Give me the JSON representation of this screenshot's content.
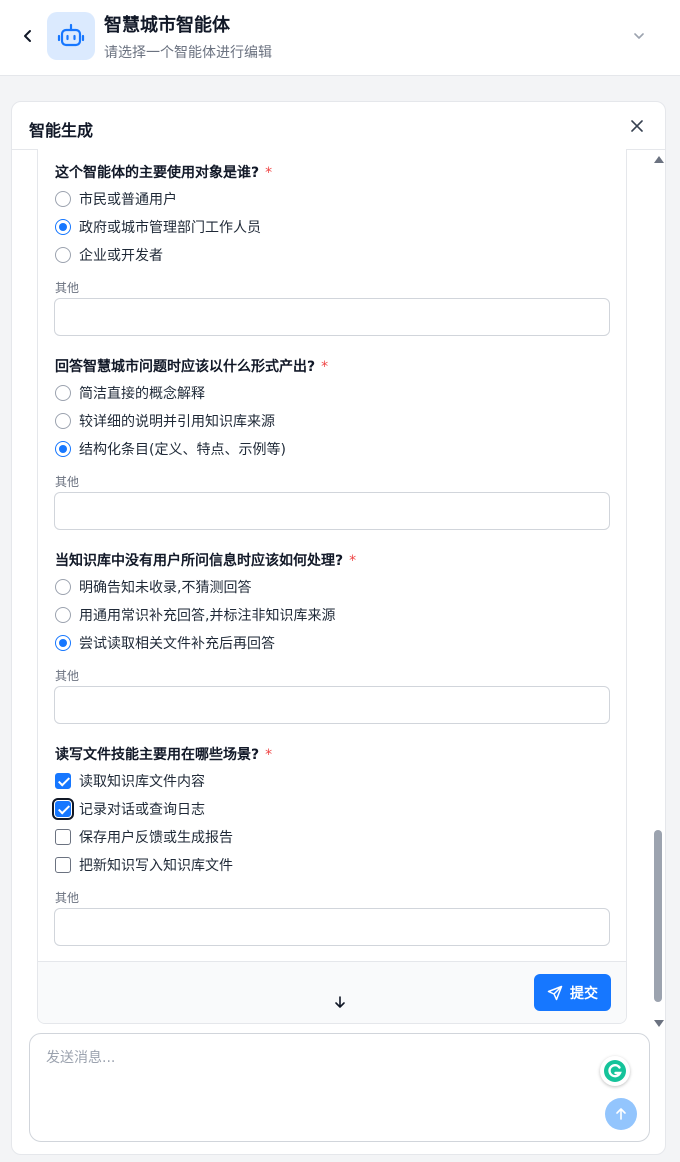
{
  "header": {
    "agent_name": "智慧城市智能体",
    "agent_subtitle": "请选择一个智能体进行编辑"
  },
  "panel": {
    "title": "智能生成"
  },
  "questions": [
    {
      "title": "这个智能体的主要使用对象是谁?",
      "required_mark": "*",
      "type": "radio",
      "options": [
        {
          "label": "市民或普通用户",
          "selected": false
        },
        {
          "label": "政府或城市管理部门工作人员",
          "selected": true
        },
        {
          "label": "企业或开发者",
          "selected": false
        }
      ],
      "other_label": "其他"
    },
    {
      "title": "回答智慧城市问题时应该以什么形式产出?",
      "required_mark": "*",
      "type": "radio",
      "options": [
        {
          "label": "简洁直接的概念解释",
          "selected": false
        },
        {
          "label": "较详细的说明并引用知识库来源",
          "selected": false
        },
        {
          "label": "结构化条目(定义、特点、示例等)",
          "selected": true
        }
      ],
      "other_label": "其他"
    },
    {
      "title": "当知识库中没有用户所问信息时应该如何处理?",
      "required_mark": "*",
      "type": "radio",
      "options": [
        {
          "label": "明确告知未收录,不猜测回答",
          "selected": false
        },
        {
          "label": "用通用常识补充回答,并标注非知识库来源",
          "selected": false
        },
        {
          "label": "尝试读取相关文件补充后再回答",
          "selected": true
        }
      ],
      "other_label": "其他"
    },
    {
      "title": "读写文件技能主要用在哪些场景?",
      "required_mark": "*",
      "type": "checkbox",
      "options": [
        {
          "label": "读取知识库文件内容",
          "selected": true
        },
        {
          "label": "记录对话或查询日志",
          "selected": true
        },
        {
          "label": "保存用户反馈或生成报告",
          "selected": false
        },
        {
          "label": "把新知识写入知识库文件",
          "selected": false
        }
      ],
      "other_label": "其他"
    }
  ],
  "footer": {
    "submit_label": "提交"
  },
  "chat": {
    "placeholder": "发送消息..."
  },
  "icons": {
    "back": "chevron-left-icon",
    "avatar": "robot-icon",
    "dropdown": "chevron-down-icon",
    "close": "close-icon",
    "scroll_down": "arrow-down-icon",
    "submit": "send-icon",
    "send": "arrow-up-icon",
    "grammarly": "grammarly-icon"
  },
  "colors": {
    "accent": "#1677ff",
    "required": "#ef4444",
    "send_button_disabled": "#93c5fd",
    "avatar_bg": "#dbeafe"
  }
}
